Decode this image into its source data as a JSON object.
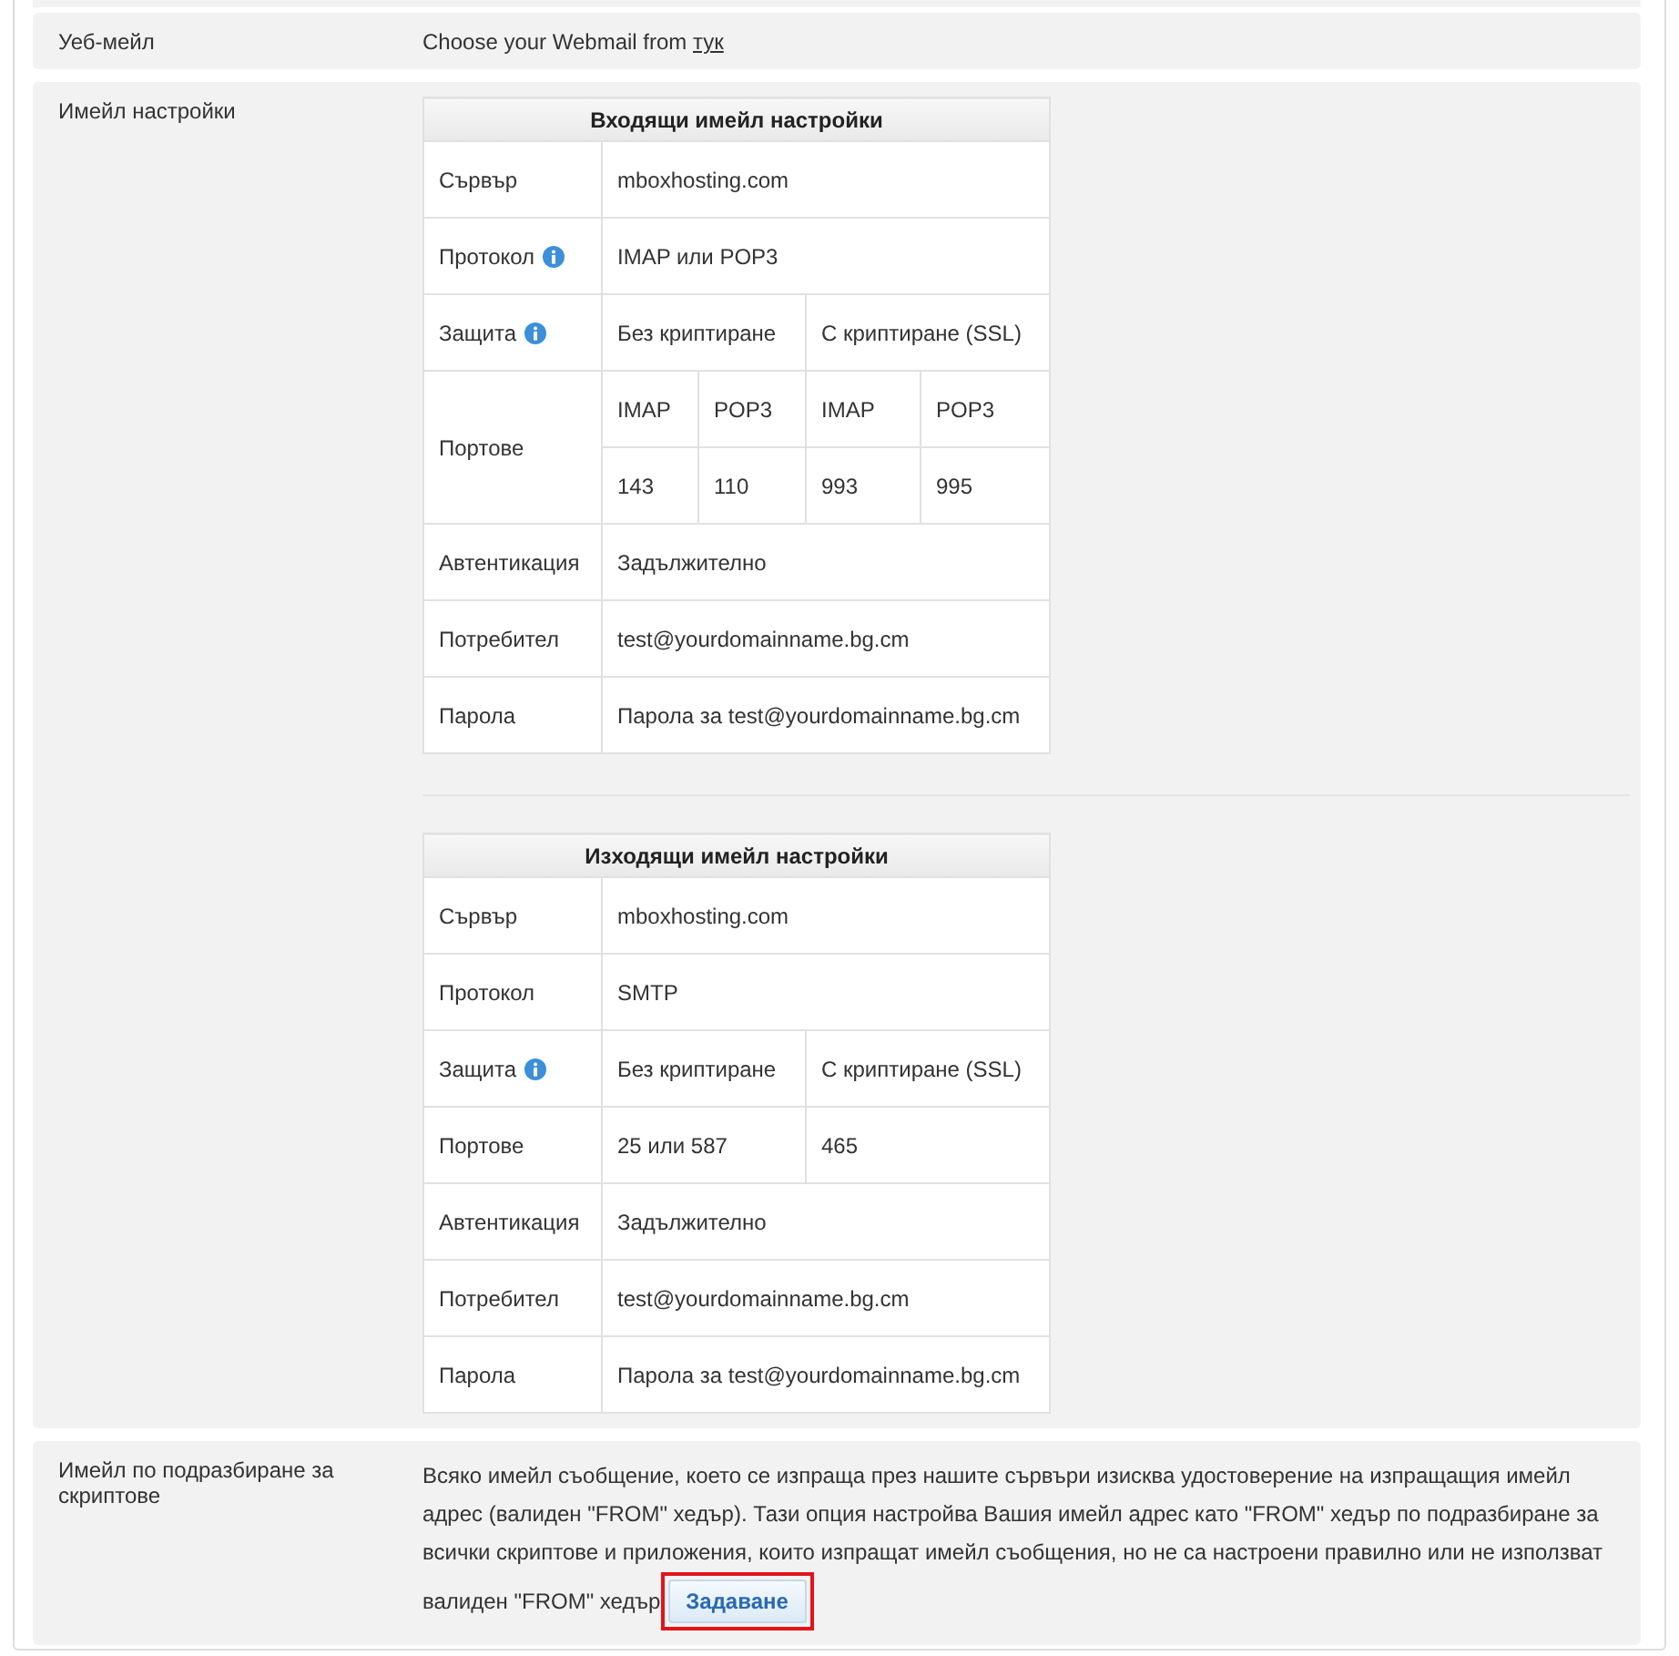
{
  "rows": [
    {
      "kind": "webmail",
      "label": "Уеб-мейл",
      "text": "Choose your Webmail from ",
      "link": "тук"
    },
    {
      "kind": "tables",
      "label": "Имейл настройки",
      "tables": [
        {
          "title": "Входящи имейл настройки",
          "rows": [
            {
              "label": "Сървър",
              "info": false,
              "lines": [
                [
                  {
                    "text": "mboxhosting.com",
                    "colspan": 4
                  }
                ]
              ]
            },
            {
              "label": "Протокол",
              "info": true,
              "lines": [
                [
                  {
                    "text": "IMAP или POP3",
                    "colspan": 4
                  }
                ]
              ]
            },
            {
              "label": "Защита",
              "info": true,
              "lines": [
                [
                  {
                    "text": "Без криптиране",
                    "colspan": 2
                  },
                  {
                    "text": "С криптиране (SSL)",
                    "colspan": 2
                  }
                ]
              ]
            },
            {
              "label": "Портове",
              "info": false,
              "rowspan": 2,
              "lines": [
                [
                  {
                    "text": "IMAP"
                  },
                  {
                    "text": "POP3"
                  },
                  {
                    "text": "IMAP"
                  },
                  {
                    "text": "POP3"
                  }
                ],
                [
                  {
                    "text": "143"
                  },
                  {
                    "text": "110"
                  },
                  {
                    "text": "993"
                  },
                  {
                    "text": "995"
                  }
                ]
              ]
            },
            {
              "label": "Автентикация",
              "info": false,
              "lines": [
                [
                  {
                    "text": "Задължително",
                    "colspan": 4
                  }
                ]
              ]
            },
            {
              "label": "Потребител",
              "info": false,
              "lines": [
                [
                  {
                    "text": "test@yourdomainname.bg.cm",
                    "colspan": 4
                  }
                ]
              ]
            },
            {
              "label": "Парола",
              "info": false,
              "lines": [
                [
                  {
                    "text": "Парола за test@yourdomainname.bg.cm",
                    "colspan": 4
                  }
                ]
              ]
            }
          ]
        },
        {
          "title": "Изходящи имейл настройки",
          "rows": [
            {
              "label": "Сървър",
              "info": false,
              "lines": [
                [
                  {
                    "text": "mboxhosting.com",
                    "colspan": 4
                  }
                ]
              ]
            },
            {
              "label": "Протокол",
              "info": false,
              "lines": [
                [
                  {
                    "text": "SMTP",
                    "colspan": 4
                  }
                ]
              ]
            },
            {
              "label": "Защита",
              "info": true,
              "lines": [
                [
                  {
                    "text": "Без криптиране",
                    "colspan": 2
                  },
                  {
                    "text": "С криптиране (SSL)",
                    "colspan": 2
                  }
                ]
              ]
            },
            {
              "label": "Портове",
              "info": false,
              "lines": [
                [
                  {
                    "text": "25 или 587",
                    "colspan": 2
                  },
                  {
                    "text": "465",
                    "colspan": 2
                  }
                ]
              ]
            },
            {
              "label": "Автентикация",
              "info": false,
              "lines": [
                [
                  {
                    "text": "Задължително",
                    "colspan": 4
                  }
                ]
              ]
            },
            {
              "label": "Потребител",
              "info": false,
              "lines": [
                [
                  {
                    "text": "test@yourdomainname.bg.cm",
                    "colspan": 4
                  }
                ]
              ]
            },
            {
              "label": "Парола",
              "info": false,
              "lines": [
                [
                  {
                    "text": "Парола за test@yourdomainname.bg.cm",
                    "colspan": 4
                  }
                ]
              ]
            }
          ]
        }
      ]
    },
    {
      "kind": "default",
      "label": "Имейл по подразбиране за скриптове",
      "text": "Всяко имейл съобщение, което се изпраща през нашите сървъри изисква удостоверение на изпращащия имейл адрес (валиден \"FROM\" хедър). Тази опция настройва Вашия имейл адрес като \"FROM\" хедър по подразбиране за всички скриптове и приложения, които изпращат имейл съобщения, но не са настроени правилно или не използват",
      "tail": "валиден \"FROM\" хедър",
      "button": {
        "label": "Задаване",
        "highlighted": true
      }
    }
  ]
}
